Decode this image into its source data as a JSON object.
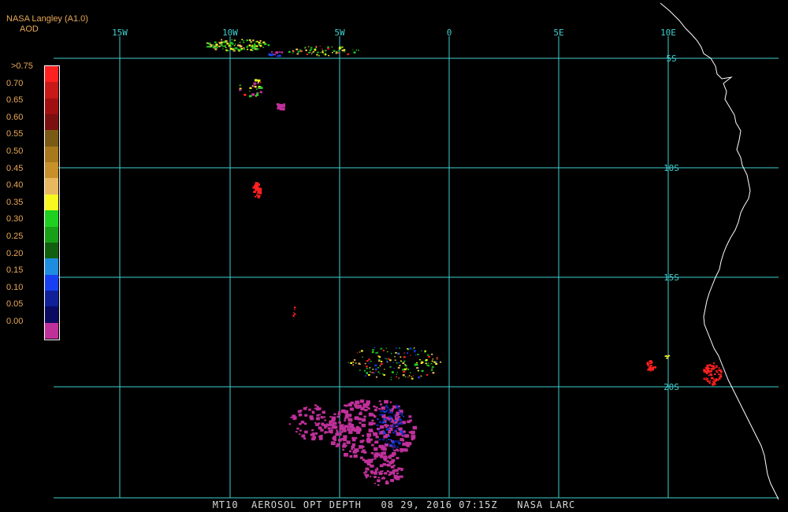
{
  "header": {
    "source": "NASA Langley (A1.0)",
    "product": "AOD"
  },
  "legend": {
    "labels": [
      ">0.75",
      "0.70",
      "0.65",
      "0.60",
      "0.55",
      "0.50",
      "0.45",
      "0.40",
      "0.35",
      "0.30",
      "0.25",
      "0.20",
      "0.15",
      "0.10",
      "0.05",
      "0.00"
    ],
    "colors": [
      "#ff2020",
      "#c81818",
      "#a01010",
      "#7a1010",
      "#7a5a14",
      "#a8781c",
      "#c8902a",
      "#e8b860",
      "#f8f820",
      "#20d020",
      "#18a018",
      "#106010",
      "#1e8ce0",
      "#1840f0",
      "#102098",
      "#0a0a60",
      "#c0309a"
    ]
  },
  "axes": {
    "lon_labels": [
      "15W",
      "10W",
      "5W",
      "0",
      "5E",
      "10E"
    ],
    "lat_labels": [
      "5S",
      "10S",
      "15S",
      "20S"
    ]
  },
  "colors": {
    "grid": "#40d0d0",
    "coast": "#ffffff",
    "text": "#e8a858",
    "aod_high": "#ff2020",
    "aod_low": "#c0309a",
    "aod_blue": "#1840f0",
    "aod_green": "#20d020",
    "aod_yellow": "#f8f820"
  },
  "footer": "MT10  AEROSOL OPT DEPTH   08 29, 2016 07:15Z   NASA LARC"
}
